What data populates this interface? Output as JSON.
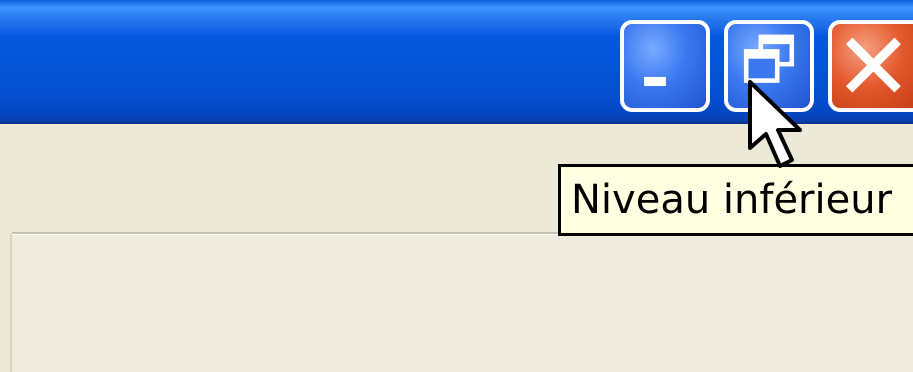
{
  "title_bar": {
    "buttons": [
      {
        "name": "minimize",
        "icon": "minimize-icon"
      },
      {
        "name": "restore",
        "icon": "restore-icon"
      },
      {
        "name": "close",
        "icon": "close-icon"
      }
    ],
    "colors": {
      "titlebar": "#0454d6",
      "caption_button_blue": "#3b78f0",
      "caption_button_close": "#e45a2e",
      "window_body": "#ece9d8"
    }
  },
  "tooltip": {
    "text": "Niveau inférieur",
    "background": "#ffffe1"
  },
  "cursor": {
    "icon": "arrow-cursor-icon"
  }
}
